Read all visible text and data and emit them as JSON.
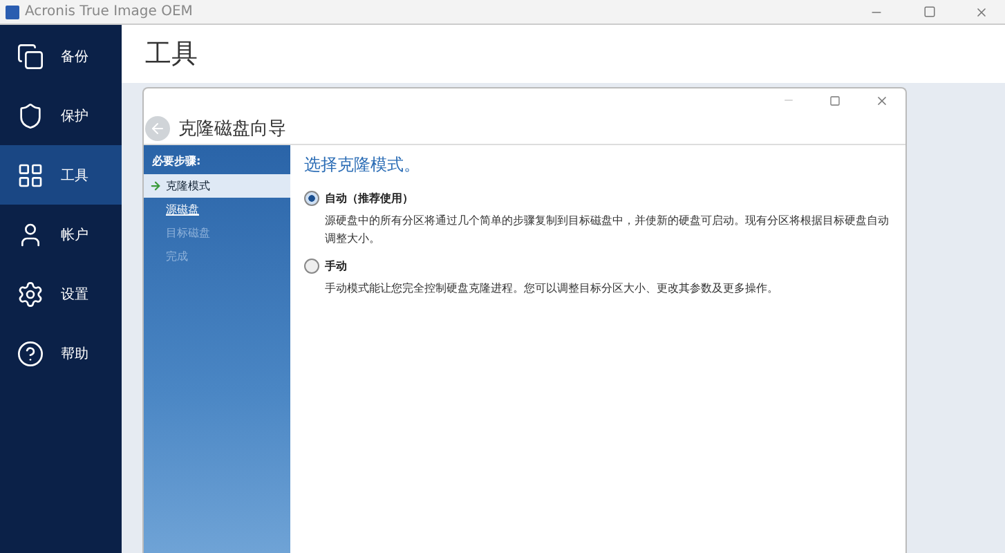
{
  "window": {
    "title": "Acronis True Image OEM"
  },
  "sidebar": {
    "items": [
      {
        "label": "备份",
        "selected": false
      },
      {
        "label": "保护",
        "selected": false
      },
      {
        "label": "工具",
        "selected": true
      },
      {
        "label": "帐户",
        "selected": false
      },
      {
        "label": "设置",
        "selected": false
      },
      {
        "label": "帮助",
        "selected": false
      }
    ]
  },
  "page": {
    "title": "工具"
  },
  "dialog": {
    "title": "克隆磁盘向导",
    "steps_heading": "必要步骤:",
    "steps": [
      {
        "label": "克隆模式",
        "selected": true,
        "disabled": false
      },
      {
        "label": "源磁盘",
        "selected": false,
        "disabled": false
      },
      {
        "label": "目标磁盘",
        "selected": false,
        "disabled": true
      },
      {
        "label": "完成",
        "selected": false,
        "disabled": true
      }
    ],
    "heading": "选择克隆模式。",
    "options": [
      {
        "label": "自动（推荐使用）",
        "selected": true,
        "description": "源硬盘中的所有分区将通过几个简单的步骤复制到目标磁盘中，并使新的硬盘可启动。现有分区将根据目标硬盘自动调整大小。"
      },
      {
        "label": "手动",
        "selected": false,
        "description": "手动模式能让您完全控制硬盘克隆进程。您可以调整目标分区大小、更改其参数及更多操作。"
      }
    ]
  }
}
